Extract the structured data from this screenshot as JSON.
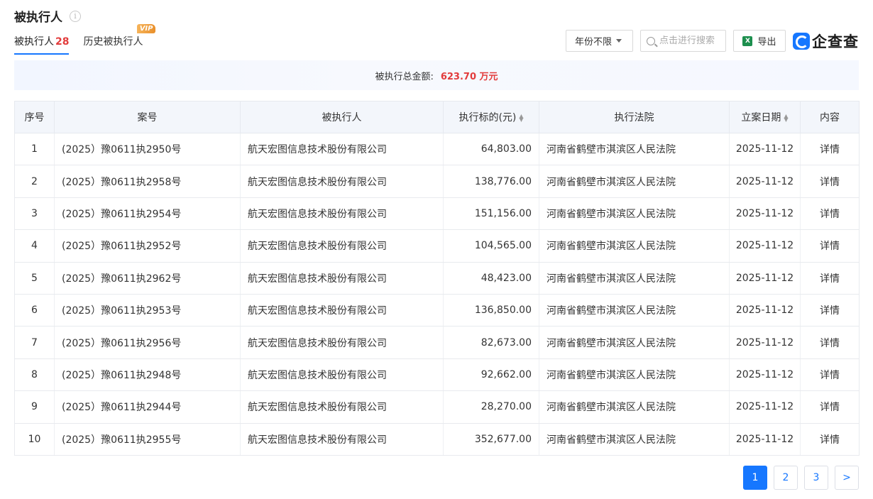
{
  "header": {
    "title": "被执行人",
    "info_icon": "i"
  },
  "tabs": [
    {
      "label": "被执行人",
      "count": "28",
      "active": true
    },
    {
      "label": "历史被执行人",
      "badge": "VIP",
      "active": false
    }
  ],
  "toolbar": {
    "year_filter": "年份不限",
    "search_placeholder": "点击进行搜索",
    "export_label": "导出",
    "excel_icon": "X",
    "brand": "企查查"
  },
  "summary": {
    "label": "被执行总金额:",
    "amount": "623.70 万元"
  },
  "table": {
    "columns": [
      "序号",
      "案号",
      "被执行人",
      "执行标的(元)",
      "执行法院",
      "立案日期",
      "内容"
    ],
    "sort_icon": "▲▼",
    "rows": [
      {
        "no": "1",
        "case": "(2025）豫0611执2950号",
        "case_link": false,
        "party": "航天宏图信息技术股份有限公司",
        "amount": "64,803.00",
        "court": "河南省鹤壁市淇滨区人民法院",
        "date": "2025-11-12",
        "action": "详情"
      },
      {
        "no": "2",
        "case": "(2025）豫0611执2958号",
        "case_link": false,
        "party": "航天宏图信息技术股份有限公司",
        "amount": "138,776.00",
        "court": "河南省鹤壁市淇滨区人民法院",
        "date": "2025-11-12",
        "action": "详情"
      },
      {
        "no": "3",
        "case": "(2025）豫0611执2954号",
        "case_link": true,
        "party": "航天宏图信息技术股份有限公司",
        "amount": "151,156.00",
        "court": "河南省鹤壁市淇滨区人民法院",
        "date": "2025-11-12",
        "action": "详情"
      },
      {
        "no": "4",
        "case": "(2025）豫0611执2952号",
        "case_link": true,
        "party": "航天宏图信息技术股份有限公司",
        "amount": "104,565.00",
        "court": "河南省鹤壁市淇滨区人民法院",
        "date": "2025-11-12",
        "action": "详情"
      },
      {
        "no": "5",
        "case": "(2025）豫0611执2962号",
        "case_link": false,
        "party": "航天宏图信息技术股份有限公司",
        "amount": "48,423.00",
        "court": "河南省鹤壁市淇滨区人民法院",
        "date": "2025-11-12",
        "action": "详情"
      },
      {
        "no": "6",
        "case": "(2025）豫0611执2953号",
        "case_link": true,
        "party": "航天宏图信息技术股份有限公司",
        "amount": "136,850.00",
        "court": "河南省鹤壁市淇滨区人民法院",
        "date": "2025-11-12",
        "action": "详情"
      },
      {
        "no": "7",
        "case": "(2025）豫0611执2956号",
        "case_link": true,
        "party": "航天宏图信息技术股份有限公司",
        "amount": "82,673.00",
        "court": "河南省鹤壁市淇滨区人民法院",
        "date": "2025-11-12",
        "action": "详情"
      },
      {
        "no": "8",
        "case": "(2025）豫0611执2948号",
        "case_link": false,
        "party": "航天宏图信息技术股份有限公司",
        "amount": "92,662.00",
        "court": "河南省鹤壁市淇滨区人民法院",
        "date": "2025-11-12",
        "action": "详情"
      },
      {
        "no": "9",
        "case": "(2025）豫0611执2944号",
        "case_link": false,
        "party": "航天宏图信息技术股份有限公司",
        "amount": "28,270.00",
        "court": "河南省鹤壁市淇滨区人民法院",
        "date": "2025-11-12",
        "action": "详情"
      },
      {
        "no": "10",
        "case": "(2025）豫0611执2955号",
        "case_link": true,
        "party": "航天宏图信息技术股份有限公司",
        "amount": "352,677.00",
        "court": "河南省鹤壁市淇滨区人民法院",
        "date": "2025-11-12",
        "action": "详情"
      }
    ]
  },
  "pagination": {
    "pages": [
      "1",
      "2",
      "3"
    ],
    "current": "1",
    "next": ">"
  },
  "colors": {
    "accent": "#1677ff",
    "amount_red": "#e23b3b",
    "header_bg": "#f3f6fb"
  }
}
